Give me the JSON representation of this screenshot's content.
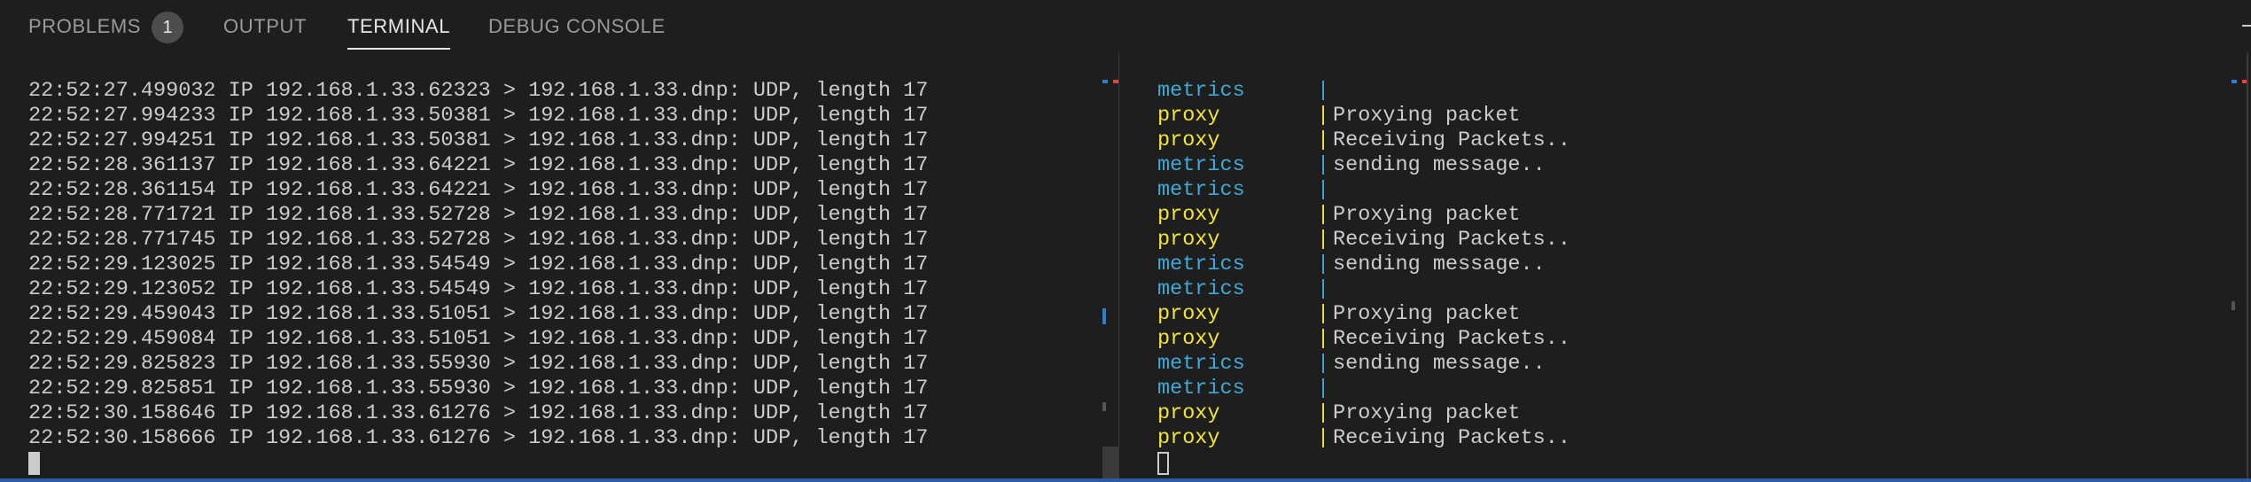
{
  "tabs": [
    {
      "label": "PROBLEMS",
      "badge": "1",
      "active": false
    },
    {
      "label": "OUTPUT",
      "active": false
    },
    {
      "label": "TERMINAL",
      "active": true
    },
    {
      "label": "DEBUG CONSOLE",
      "active": false
    }
  ],
  "left_terminal": {
    "lines": [
      "22:52:27.499032 IP 192.168.1.33.62323 > 192.168.1.33.dnp: UDP, length 17",
      "22:52:27.994233 IP 192.168.1.33.50381 > 192.168.1.33.dnp: UDP, length 17",
      "22:52:27.994251 IP 192.168.1.33.50381 > 192.168.1.33.dnp: UDP, length 17",
      "22:52:28.361137 IP 192.168.1.33.64221 > 192.168.1.33.dnp: UDP, length 17",
      "22:52:28.361154 IP 192.168.1.33.64221 > 192.168.1.33.dnp: UDP, length 17",
      "22:52:28.771721 IP 192.168.1.33.52728 > 192.168.1.33.dnp: UDP, length 17",
      "22:52:28.771745 IP 192.168.1.33.52728 > 192.168.1.33.dnp: UDP, length 17",
      "22:52:29.123025 IP 192.168.1.33.54549 > 192.168.1.33.dnp: UDP, length 17",
      "22:52:29.123052 IP 192.168.1.33.54549 > 192.168.1.33.dnp: UDP, length 17",
      "22:52:29.459043 IP 192.168.1.33.51051 > 192.168.1.33.dnp: UDP, length 17",
      "22:52:29.459084 IP 192.168.1.33.51051 > 192.168.1.33.dnp: UDP, length 17",
      "22:52:29.825823 IP 192.168.1.33.55930 > 192.168.1.33.dnp: UDP, length 17",
      "22:52:29.825851 IP 192.168.1.33.55930 > 192.168.1.33.dnp: UDP, length 17",
      "22:52:30.158646 IP 192.168.1.33.61276 > 192.168.1.33.dnp: UDP, length 17",
      "22:52:30.158666 IP 192.168.1.33.61276 > 192.168.1.33.dnp: UDP, length 17"
    ]
  },
  "right_terminal": {
    "separator": "|",
    "lines": [
      {
        "service": "metrics",
        "message": ""
      },
      {
        "service": "proxy",
        "message": "Proxying packet"
      },
      {
        "service": "proxy",
        "message": "Receiving Packets.."
      },
      {
        "service": "metrics",
        "message": "sending message.."
      },
      {
        "service": "metrics",
        "message": ""
      },
      {
        "service": "proxy",
        "message": "Proxying packet"
      },
      {
        "service": "proxy",
        "message": "Receiving Packets.."
      },
      {
        "service": "metrics",
        "message": "sending message.."
      },
      {
        "service": "metrics",
        "message": ""
      },
      {
        "service": "proxy",
        "message": "Proxying packet"
      },
      {
        "service": "proxy",
        "message": "Receiving Packets.."
      },
      {
        "service": "metrics",
        "message": "sending message.."
      },
      {
        "service": "metrics",
        "message": ""
      },
      {
        "service": "proxy",
        "message": "Proxying packet"
      },
      {
        "service": "proxy",
        "message": "Receiving Packets.."
      }
    ]
  },
  "colors": {
    "background": "#1e1e1e",
    "text": "#cccccc",
    "metrics": "#3fa9d6",
    "proxy": "#f0e633",
    "tab_active": "#e7e7e7",
    "tab_inactive": "#9a9a9a",
    "badge_bg": "#4d4d4d",
    "overview_red": "#e04a3a",
    "overview_blue": "#2f7fd0"
  }
}
